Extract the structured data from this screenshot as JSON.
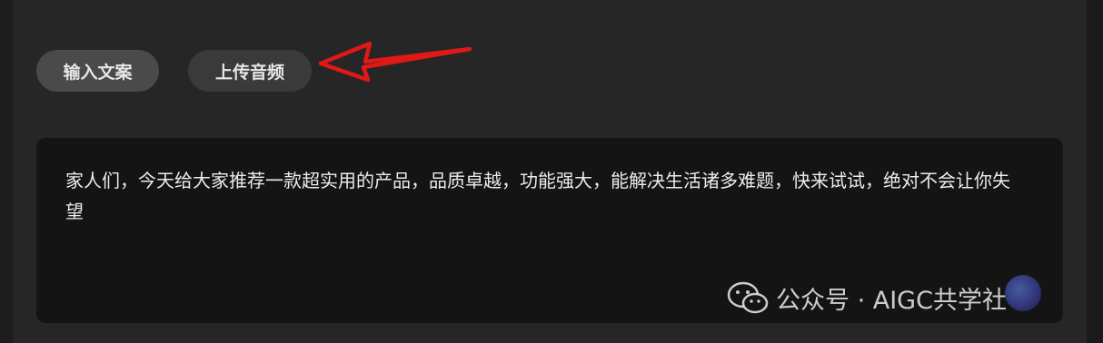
{
  "tabs": {
    "input_text_label": "输入文案",
    "upload_audio_label": "上传音频"
  },
  "textbox": {
    "content": "家人们，今天给大家推荐一款超实用的产品，品质卓越，功能强大，能解决生活诸多难题，快来试试，绝对不会让你失望"
  },
  "annotation": {
    "arrow_color": "#e01818"
  },
  "watermark": {
    "text": "公众号 · AIGC共学社",
    "icon": "wechat-icon"
  },
  "colors": {
    "background": "#262626",
    "textbox_bg": "#141414",
    "button_bg": "#474747"
  }
}
